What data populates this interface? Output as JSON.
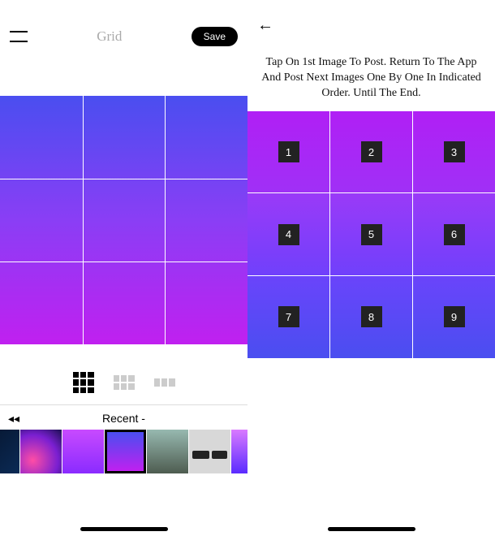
{
  "left": {
    "title": "Grid",
    "save_label": "Save",
    "menu_name": "menu",
    "layouts": [
      "grid-3x3",
      "grid-3x2",
      "grid-3x1"
    ],
    "recent_label": "Recent -",
    "rewind_name": "rewind",
    "thumbs": [
      0,
      1,
      2,
      3,
      4,
      5,
      6
    ]
  },
  "right": {
    "back_name": "back",
    "instructions": "Tap On 1st Image To Post. Return To The App And Post Next Images One By One In Indicated Order. Until The End.",
    "cells": [
      "1",
      "2",
      "3",
      "4",
      "5",
      "6",
      "7",
      "8",
      "9"
    ]
  }
}
